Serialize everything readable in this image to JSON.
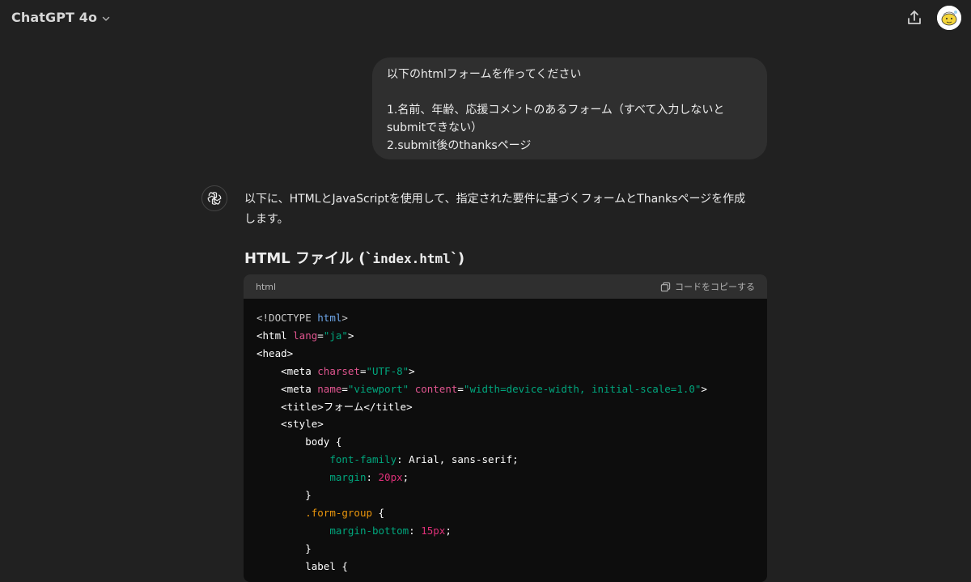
{
  "header": {
    "model_name": "ChatGPT 4o",
    "share_icon": "share-upload-icon",
    "avatar_icon": "user-avatar"
  },
  "user_message": {
    "lines": [
      "以下のhtmlフォームを作ってください",
      "",
      "1.名前、年齢、応援コメントのあるフォーム（すべて入力しないと",
      "submitできない）",
      "2.submit後のthanksページ"
    ]
  },
  "assistant": {
    "icon": "openai-logo-icon",
    "intro_line1": "以下に、HTMLとJavaScriptを使用して、指定された要件に基づくフォームとThanksページを作成",
    "intro_line2": "します。",
    "heading_prefix": "HTML ファイル (`",
    "heading_code": "index.html",
    "heading_suffix": "`)"
  },
  "code_block": {
    "language": "html",
    "copy_label": "コードをコピーする",
    "colors": {
      "tag": "#ffffff",
      "keyword": "#6ea6e8",
      "attribute": "#e0558f",
      "string": "#00a67d",
      "property": "#00a67d",
      "number": "#df3079",
      "selector": "#e9950c"
    },
    "lines": [
      [
        {
          "t": "<!DOCTYPE ",
          "c": "doctype"
        },
        {
          "t": "html",
          "c": "kw"
        },
        {
          "t": ">",
          "c": "doctype"
        }
      ],
      [
        {
          "t": "<html ",
          "c": "plain"
        },
        {
          "t": "lang",
          "c": "attr"
        },
        {
          "t": "=",
          "c": "plain"
        },
        {
          "t": "\"ja\"",
          "c": "str"
        },
        {
          "t": ">",
          "c": "plain"
        }
      ],
      [
        {
          "t": "<head>",
          "c": "plain"
        }
      ],
      [
        {
          "t": "    <meta ",
          "c": "plain"
        },
        {
          "t": "charset",
          "c": "attr"
        },
        {
          "t": "=",
          "c": "plain"
        },
        {
          "t": "\"UTF-8\"",
          "c": "str"
        },
        {
          "t": ">",
          "c": "plain"
        }
      ],
      [
        {
          "t": "    <meta ",
          "c": "plain"
        },
        {
          "t": "name",
          "c": "attr"
        },
        {
          "t": "=",
          "c": "plain"
        },
        {
          "t": "\"viewport\"",
          "c": "str"
        },
        {
          "t": " ",
          "c": "plain"
        },
        {
          "t": "content",
          "c": "attr"
        },
        {
          "t": "=",
          "c": "plain"
        },
        {
          "t": "\"width=device-width, initial-scale=1.0\"",
          "c": "str"
        },
        {
          "t": ">",
          "c": "plain"
        }
      ],
      [
        {
          "t": "    <title>フォーム</title>",
          "c": "plain"
        }
      ],
      [
        {
          "t": "    <style>",
          "c": "plain"
        }
      ],
      [
        {
          "t": "        body {",
          "c": "plain"
        }
      ],
      [
        {
          "t": "            ",
          "c": "plain"
        },
        {
          "t": "font-family",
          "c": "prop"
        },
        {
          "t": ": Arial, sans-serif;",
          "c": "plain"
        }
      ],
      [
        {
          "t": "            ",
          "c": "plain"
        },
        {
          "t": "margin",
          "c": "prop"
        },
        {
          "t": ": ",
          "c": "plain"
        },
        {
          "t": "20px",
          "c": "num"
        },
        {
          "t": ";",
          "c": "plain"
        }
      ],
      [
        {
          "t": "        }",
          "c": "plain"
        }
      ],
      [
        {
          "t": "        ",
          "c": "plain"
        },
        {
          "t": ".form-group",
          "c": "sel"
        },
        {
          "t": " {",
          "c": "plain"
        }
      ],
      [
        {
          "t": "            ",
          "c": "plain"
        },
        {
          "t": "margin-bottom",
          "c": "prop"
        },
        {
          "t": ": ",
          "c": "plain"
        },
        {
          "t": "15px",
          "c": "num"
        },
        {
          "t": ";",
          "c": "plain"
        }
      ],
      [
        {
          "t": "        }",
          "c": "plain"
        }
      ],
      [
        {
          "t": "        label {",
          "c": "plain"
        }
      ]
    ]
  }
}
